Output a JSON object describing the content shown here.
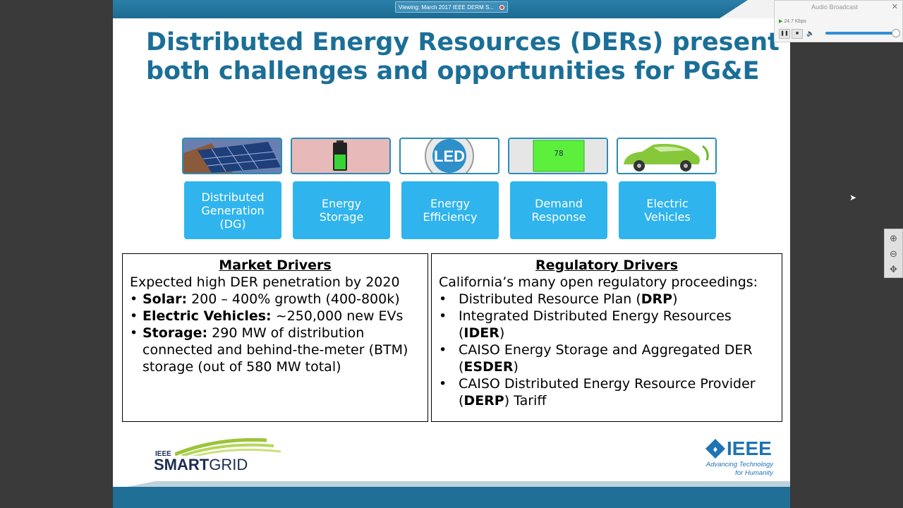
{
  "viewer": {
    "tab_label": "Viewing: March 2017 IEEE DERM S...",
    "audio_title": "Audio Broadcast",
    "audio_rate": "24.7 Kbps",
    "accent_color": "#1b6f97"
  },
  "slide": {
    "title": "Distributed Energy Resources (DERs) present both challenges and opportunities for PG&E",
    "categories": [
      {
        "label": "Distributed\nGeneration\n(DG)",
        "image": "solar-panels-icon"
      },
      {
        "label": "Energy\nStorage",
        "image": "battery-icon"
      },
      {
        "label": "Energy\nEfficiency",
        "image": "led-badge-icon"
      },
      {
        "label": "Demand\nResponse",
        "image": "thermostat-icon"
      },
      {
        "label": "Electric\nVehicles",
        "image": "electric-car-icon"
      }
    ],
    "market": {
      "heading": "Market Drivers",
      "intro": "Expected high DER penetration by 2020",
      "bullets": [
        {
          "bold": "Solar:",
          "text": " 200 – 400% growth (400-800k)"
        },
        {
          "bold": "Electric Vehicles:",
          "text": " ~250,000 new EVs"
        },
        {
          "bold": "Storage:",
          "text": " 290 MW of distribution connected and behind-the-meter (BTM) storage (out of 580 MW total)"
        }
      ]
    },
    "regulatory": {
      "heading": "Regulatory Drivers",
      "intro": "California’s many open regulatory proceedings:",
      "bullets": [
        {
          "pre": "Distributed Resource Plan (",
          "bold": "DRP",
          "post": ")"
        },
        {
          "pre": "Integrated Distributed Energy Resources (",
          "bold": "IDER",
          "post": ")"
        },
        {
          "pre": "CAISO Energy Storage and Aggregated DER (",
          "bold": "ESDER",
          "post": ")"
        },
        {
          "pre": "CAISO Distributed Energy Resource Provider (",
          "bold": "DERP",
          "post": ") Tariff"
        }
      ]
    },
    "logos": {
      "smartgrid_small": "IEEE",
      "smartgrid_big": "SMART",
      "smartgrid_big2": "GRID",
      "ieee": "IEEE",
      "ieee_tagline_1": "Advancing Technology",
      "ieee_tagline_2": "for Humanity"
    }
  }
}
